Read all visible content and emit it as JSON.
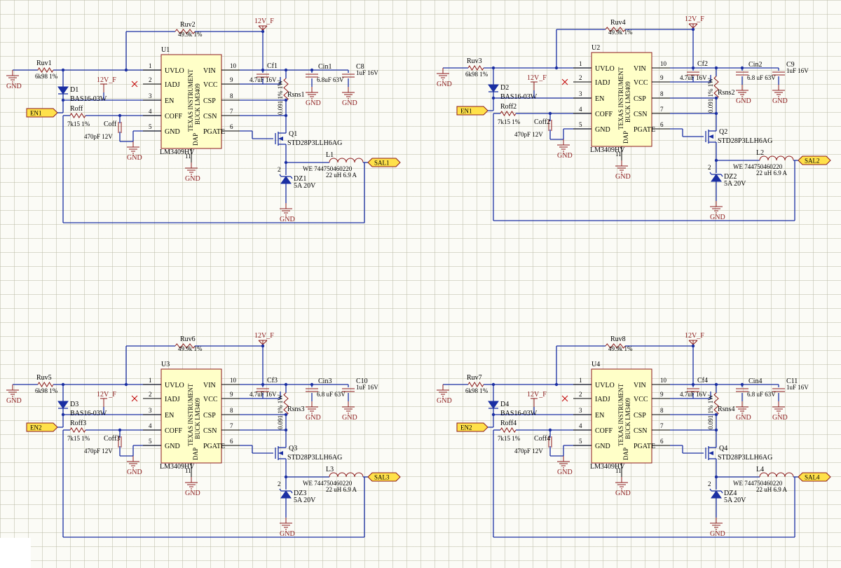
{
  "sheet": {
    "power_label": "12V_F",
    "ground_label": "GND",
    "ic_vendor": "TEXAS INSTRUMENT",
    "ic_function": "BUCK LM3409",
    "ic_part": "LM3409HV",
    "ic_pads": "DAP",
    "ic_pins": {
      "uvlo": "UVLO",
      "iadj": "IADJ",
      "en": "EN",
      "coff": "COFF",
      "gnd": "GND",
      "vin": "VIN",
      "vcc": "VCC",
      "csp": "CSP",
      "csn": "CSN",
      "pgate": "PGATE"
    },
    "pin_numbers": {
      "p1": "1",
      "p2": "2",
      "p3": "3",
      "p4": "4",
      "p5": "5",
      "p10": "10",
      "p9": "9",
      "p8": "8",
      "p7": "7",
      "p6": "6",
      "p11": "11"
    },
    "values": {
      "ruv_hi": "49.9k 1%",
      "ruv_lo": "6k98 1%",
      "roff": "7k15 1%",
      "coff": "470pF 12V",
      "cf": "4.7uF 16V",
      "c_out": "1uF 16V",
      "rsns": "0.091 1% 1W",
      "diode": "BAS16-03W",
      "fet": "STD28P3LLH6AG",
      "inductor_part": "WE 744750460220",
      "inductor_val": "22 uH 6.9 A",
      "zener": "5A 20V"
    }
  },
  "circuits": [
    {
      "u": "U1",
      "ruv_hi": "Ruv2",
      "ruv_lo": "Ruv1",
      "d": "D1",
      "en": "EN1",
      "roff": "Roff",
      "coff": "Coff",
      "cf": "Cf1",
      "cin": "Cin1",
      "cin_val": "6.8uF 63V",
      "cout": "C8",
      "rsns": "Rsns1",
      "q": "Q1",
      "l": "L1",
      "dz": "DZ1",
      "sal": "SAL1",
      "ruv_lo_val": "6k98 1%"
    },
    {
      "u": "U2",
      "ruv_hi": "Ruv4",
      "ruv_lo": "Ruv3",
      "d": "D2",
      "en": "EN1",
      "roff": "Roff2",
      "coff": "Coff2",
      "cf": "Cf2",
      "cin": "Cin2",
      "cin_val": "6.8 uF 63V",
      "cout": "C9",
      "rsns": "Rsns2",
      "q": "Q2",
      "l": "L2",
      "dz": "DZ2",
      "sal": "SAL2",
      "ruv_lo_val": "6k98 1%"
    },
    {
      "u": "U3",
      "ruv_hi": "Ruv6",
      "ruv_lo": "Ruv5",
      "d": "D3",
      "en": "EN2",
      "roff": "Roff3",
      "coff": "Coff3",
      "cf": "Cf3",
      "cin": "Cin3",
      "cin_val": "6.8 uF 63V",
      "cout": "C10",
      "rsns": "Rsns3",
      "q": "Q3",
      "l": "L3",
      "dz": "DZ3",
      "sal": "SAL3",
      "ruv_lo_val": "6k98 1%"
    },
    {
      "u": "U4",
      "ruv_hi": "Ruv8",
      "ruv_lo": "Ruv7",
      "d": "D4",
      "en": "EN2",
      "roff": "Roff4",
      "coff": "Coff4",
      "cf": "Cf4",
      "cin": "Cin4",
      "cin_val": "6.8 uF 63V",
      "cout": "C11",
      "rsns": "Rsns4",
      "q": "Q4",
      "l": "L4",
      "dz": "DZ4",
      "sal": "SAL4",
      "ruv_lo_val": "6k98 1%"
    }
  ]
}
